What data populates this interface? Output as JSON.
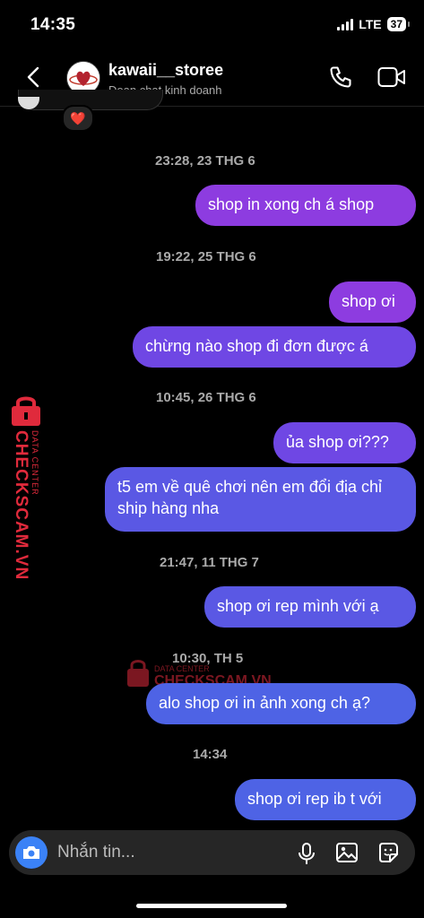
{
  "status": {
    "time": "14:35",
    "network": "LTE",
    "battery": "37"
  },
  "header": {
    "title": "kawaii__storee",
    "subtitle": "Đoạn chat kinh doanh"
  },
  "reaction": "❤️",
  "messages": [
    {
      "type": "timestamp",
      "text": "23:28, 23 THG 6"
    },
    {
      "type": "sent",
      "text": "shop in xong ch á shop"
    },
    {
      "type": "timestamp",
      "text": "19:22, 25 THG 6"
    },
    {
      "type": "sent",
      "text": "shop ơi"
    },
    {
      "type": "sent",
      "text": "chừng nào shop đi đơn được á"
    },
    {
      "type": "timestamp",
      "text": "10:45, 26 THG 6"
    },
    {
      "type": "sent",
      "text": "ủa shop ơi???"
    },
    {
      "type": "sent",
      "text": "t5 em về quê chơi nên em đổi địa chỉ ship hàng nha"
    },
    {
      "type": "timestamp",
      "text": "21:47, 11 THG 7"
    },
    {
      "type": "sent",
      "text": "shop ơi rep mình với ạ"
    },
    {
      "type": "timestamp",
      "text": "10:30, TH 5"
    },
    {
      "type": "sent",
      "text": "alo shop ơi in ảnh xong ch ạ?"
    },
    {
      "type": "timestamp",
      "text": "14:34"
    },
    {
      "type": "sent",
      "text": "shop ơi rep ib t với"
    }
  ],
  "composer": {
    "placeholder": "Nhắn tin..."
  },
  "watermark": {
    "brand": "CHECKSCAM.VN",
    "tagline": "DATA CENTER"
  },
  "colors": {
    "bubble_top": "#8d3ce0",
    "bubble_bottom": "#4e63e5",
    "watermark": "#e02a3c",
    "camera": "#3b82f6"
  }
}
